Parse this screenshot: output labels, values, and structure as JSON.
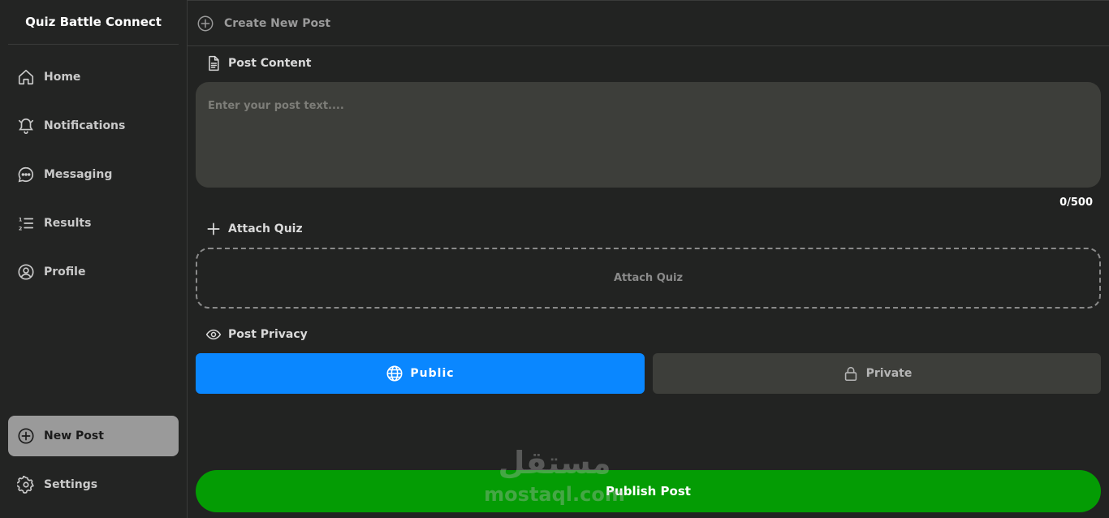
{
  "sidebar": {
    "brand": "Quiz Battle Connect",
    "items": [
      {
        "label": "Home",
        "icon": "home-icon"
      },
      {
        "label": "Notifications",
        "icon": "bell-icon"
      },
      {
        "label": "Messaging",
        "icon": "chat-icon"
      },
      {
        "label": "Results",
        "icon": "list-ordered-icon"
      },
      {
        "label": "Profile",
        "icon": "user-circle-icon"
      }
    ],
    "new_post": {
      "label": "New Post",
      "icon": "plus-circle-icon",
      "active": true
    },
    "settings": {
      "label": "Settings",
      "icon": "gear-icon"
    }
  },
  "header": {
    "title": "Create New Post",
    "icon": "plus-circle-icon"
  },
  "post_content": {
    "label": "Post Content",
    "icon": "document-icon",
    "value": "",
    "placeholder": "Enter your post text....",
    "counter": "0/500"
  },
  "attach_quiz": {
    "label": "Attach Quiz",
    "icon": "plus-icon",
    "dropzone_label": "Attach Quiz"
  },
  "privacy": {
    "label": "Post Privacy",
    "icon": "eye-icon",
    "options": [
      {
        "label": "Public",
        "icon": "globe-icon",
        "selected": true
      },
      {
        "label": "Private",
        "icon": "lock-icon",
        "selected": false
      }
    ]
  },
  "publish": {
    "label": "Publish Post"
  },
  "colors": {
    "background": "#222322",
    "accent_blue": "#0a87ff",
    "publish_green": "#049c04",
    "input_bg": "#3d3e3a"
  },
  "watermark": {
    "text_ar": "مستقل",
    "text_en": "mostaql.com"
  }
}
